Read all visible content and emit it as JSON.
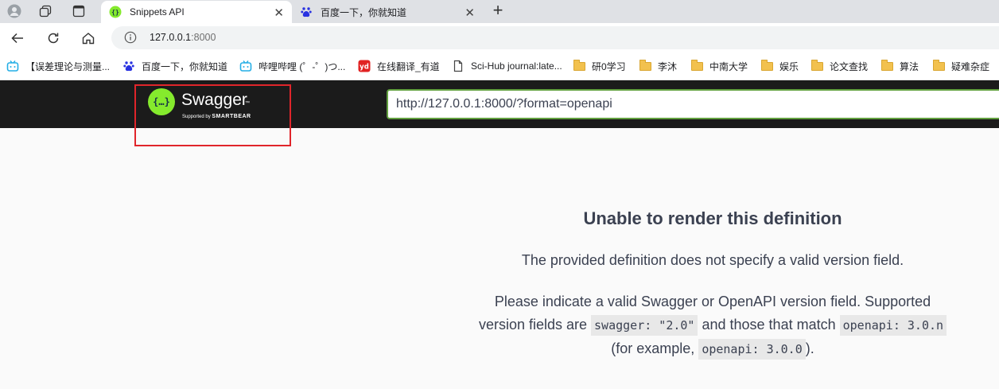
{
  "browser": {
    "tabs": [
      {
        "title": "Snippets API",
        "active": true
      },
      {
        "title": "百度一下，你就知道",
        "active": false
      }
    ],
    "close_glyph": "✕",
    "new_tab_glyph": "+",
    "address": {
      "host": "127.0.0.1",
      "port": ":8000"
    },
    "bookmarks": [
      {
        "label": "【误差理论与测量...",
        "icon": "bilibili-icon"
      },
      {
        "label": "百度一下，你就知道",
        "icon": "baidu-icon"
      },
      {
        "label": "哔哩哔哩 (゜-゜)つ...",
        "icon": "bilibili-icon"
      },
      {
        "label": "在线翻译_有道",
        "icon": "youdao-icon"
      },
      {
        "label": "Sci-Hub journal:late...",
        "icon": "page-icon"
      },
      {
        "label": "研0学习",
        "icon": "folder-icon"
      },
      {
        "label": "李沐",
        "icon": "folder-icon"
      },
      {
        "label": "中南大学",
        "icon": "folder-icon"
      },
      {
        "label": "娱乐",
        "icon": "folder-icon"
      },
      {
        "label": "论文查找",
        "icon": "folder-icon"
      },
      {
        "label": "算法",
        "icon": "folder-icon"
      },
      {
        "label": "疑难杂症",
        "icon": "folder-icon"
      }
    ]
  },
  "swagger": {
    "logo": {
      "brace": "{…}",
      "name": "Swagger",
      "tm": "™",
      "sub_prefix": "Supported by",
      "sub_brand": "SMARTBEAR"
    },
    "spec_url": "http://127.0.0.1:8000/?format=openapi",
    "error": {
      "title": "Unable to render this definition",
      "p1": "The provided definition does not specify a valid version field.",
      "p2_a": "Please indicate a valid Swagger or OpenAPI version field. Supported version fields are",
      "code1": "swagger: \"2.0\"",
      "p2_b": "and those that match",
      "code2": "openapi: 3.0.n",
      "p2_c": "(for example,",
      "code3": "openapi: 3.0.0",
      "p2_d": ")."
    }
  },
  "colors": {
    "swagger_green": "#85ea2d",
    "topbar": "#1b1b1b",
    "input_border": "#62a03f",
    "highlight": "#e0252b"
  }
}
